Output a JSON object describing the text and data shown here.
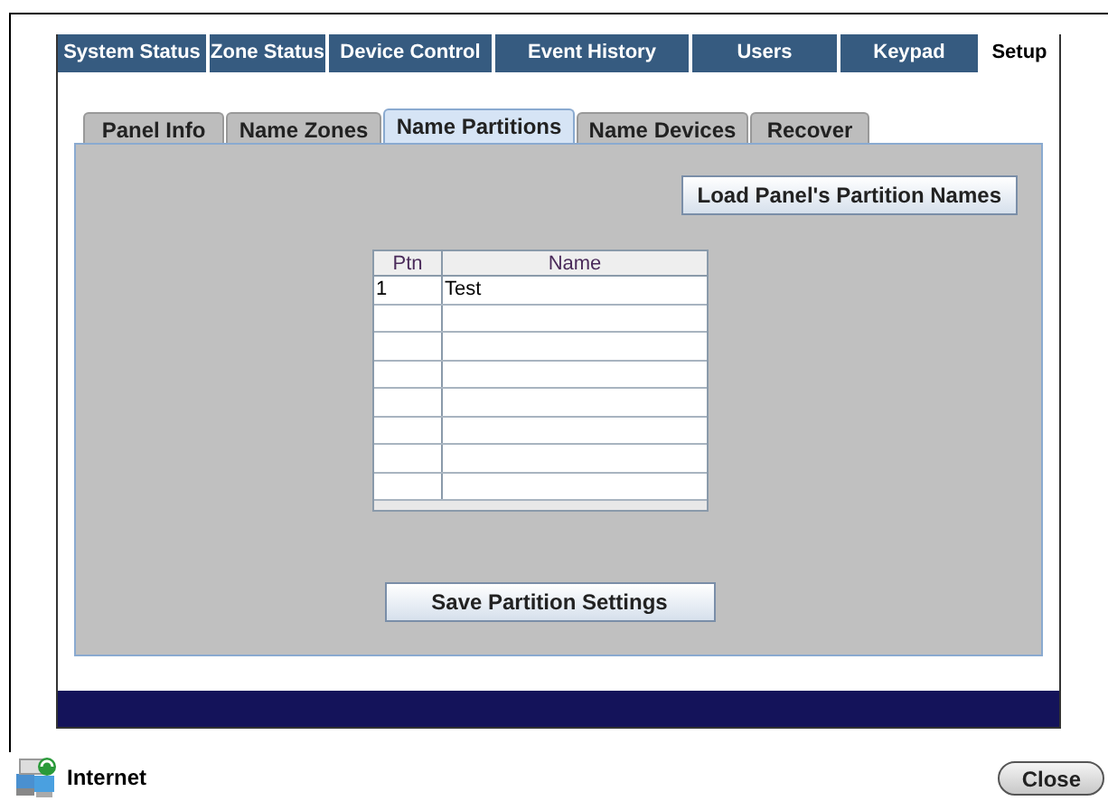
{
  "main_tabs": [
    {
      "label": "System Status",
      "selected": false
    },
    {
      "label": "Zone Status",
      "selected": false
    },
    {
      "label": "Device Control",
      "selected": false
    },
    {
      "label": "Event History",
      "selected": false
    },
    {
      "label": "Users",
      "selected": false
    },
    {
      "label": "Keypad",
      "selected": false
    },
    {
      "label": "Setup",
      "selected": true
    }
  ],
  "sub_tabs": [
    {
      "label": "Panel Info",
      "selected": false
    },
    {
      "label": "Name Zones",
      "selected": false
    },
    {
      "label": "Name Partitions",
      "selected": true
    },
    {
      "label": "Name Devices",
      "selected": false
    },
    {
      "label": "Recover",
      "selected": false
    }
  ],
  "load_button": "Load Panel's Partition Names",
  "table": {
    "columns": [
      "Ptn",
      "Name"
    ],
    "rows": [
      [
        "1",
        "Test"
      ],
      [
        "",
        ""
      ],
      [
        "",
        ""
      ],
      [
        "",
        ""
      ],
      [
        "",
        ""
      ],
      [
        "",
        ""
      ],
      [
        "",
        ""
      ],
      [
        "",
        ""
      ]
    ]
  },
  "save_button": "Save Partition Settings",
  "status_bar": {
    "zone": "Internet",
    "close_button": "Close"
  }
}
